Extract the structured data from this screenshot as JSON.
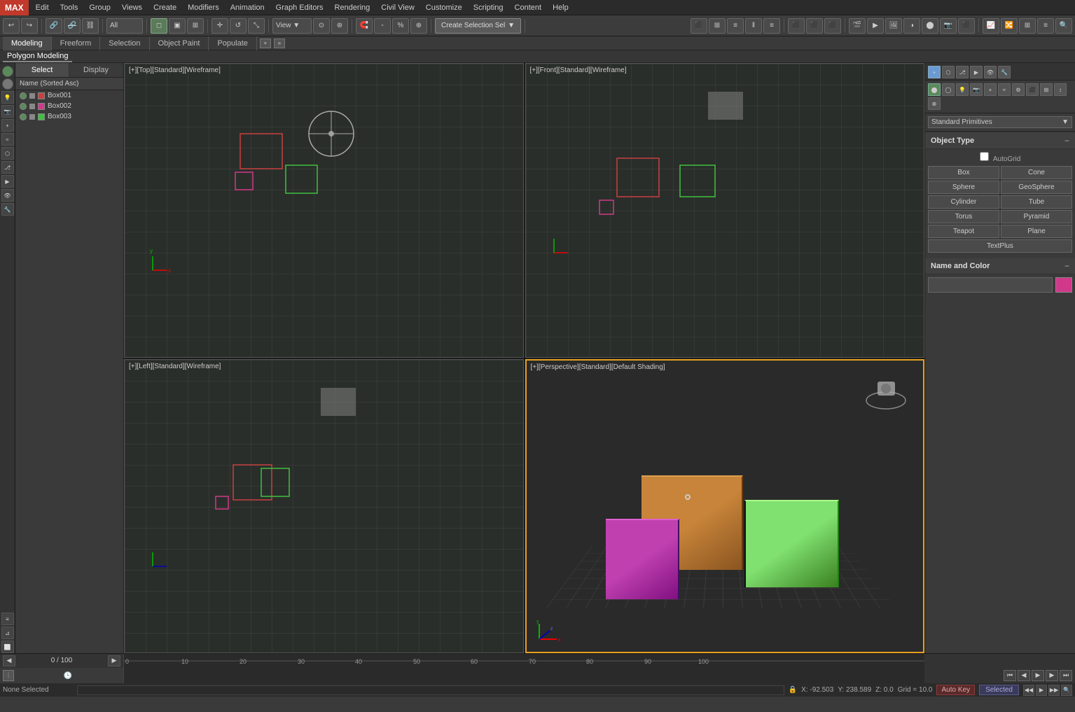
{
  "menu": {
    "max_label": "MAX",
    "items": [
      "Edit",
      "Tools",
      "Group",
      "Views",
      "Create",
      "Modifiers",
      "Animation",
      "Graph Editors",
      "Rendering",
      "Civil View",
      "Customize",
      "Scripting",
      "Content",
      "Help"
    ]
  },
  "toolbar": {
    "mode_dropdown": "All",
    "view_btn": "View",
    "create_sel_label": "Create Selection Sel",
    "create_sel_arrow": "▼"
  },
  "tabs": {
    "items": [
      "Modeling",
      "Freeform",
      "Selection",
      "Object Paint",
      "Populate"
    ],
    "active": "Modeling",
    "sub_tab": "Polygon Modeling"
  },
  "left_panel": {
    "tabs": [
      "Select",
      "Display"
    ],
    "list_header": "Name (Sorted Asc)",
    "items": [
      {
        "name": "Box001",
        "color": "#c84040"
      },
      {
        "name": "Box002",
        "color": "#d0388a"
      },
      {
        "name": "Box003",
        "color": "#40c040"
      }
    ]
  },
  "viewports": [
    {
      "label": "[+][Top][Standard][Wireframe]",
      "type": "top",
      "active": false
    },
    {
      "label": "[+][Front][Standard][Wireframe]",
      "type": "front",
      "active": false
    },
    {
      "label": "[+][Left][Standard][Wireframe]",
      "type": "left",
      "active": false
    },
    {
      "label": "[+][Perspective][Standard][Default Shading]",
      "type": "perspective",
      "active": true
    }
  ],
  "right_panel": {
    "primitives_dropdown": "Standard Primitives",
    "object_type_title": "Object Type",
    "autogrid_label": "AutoGrid",
    "buttons": [
      "Box",
      "Cone",
      "Sphere",
      "GeoSphere",
      "Cylinder",
      "Tube",
      "Torus",
      "Pyramid",
      "Teapot",
      "Plane",
      "TextPlus"
    ],
    "name_color_title": "Name and Color",
    "color_swatch": "#d0388a"
  },
  "status_bar": {
    "none_selected": "None Selected",
    "coords": "X: -92.503",
    "y_coord": "Y: 238.589",
    "z_coord": "Z: 0.0",
    "grid": "Grid = 10.0",
    "autokey": "Auto Key",
    "selected": "Selected"
  },
  "timeline": {
    "frame_current": "0",
    "frame_total": "100",
    "markers": [
      "0",
      "10",
      "20",
      "30",
      "40",
      "50",
      "60",
      "70",
      "80",
      "90",
      "100"
    ]
  },
  "icons": {
    "undo": "↩",
    "redo": "↪",
    "link": "🔗",
    "unlink": "⛓",
    "select": "↖",
    "move": "✛",
    "rotate": "↺",
    "scale": "⤡",
    "mirror": "⬛",
    "align": "≡",
    "grid": "⊞",
    "snap": "🧲",
    "plus": "+",
    "minus": "−",
    "expand": "◻",
    "pin": "📌",
    "camera": "📷",
    "light": "💡",
    "eye": "👁",
    "lock": "🔒",
    "box": "⬜",
    "sphere": "⬤",
    "cylinder": "⬛"
  }
}
